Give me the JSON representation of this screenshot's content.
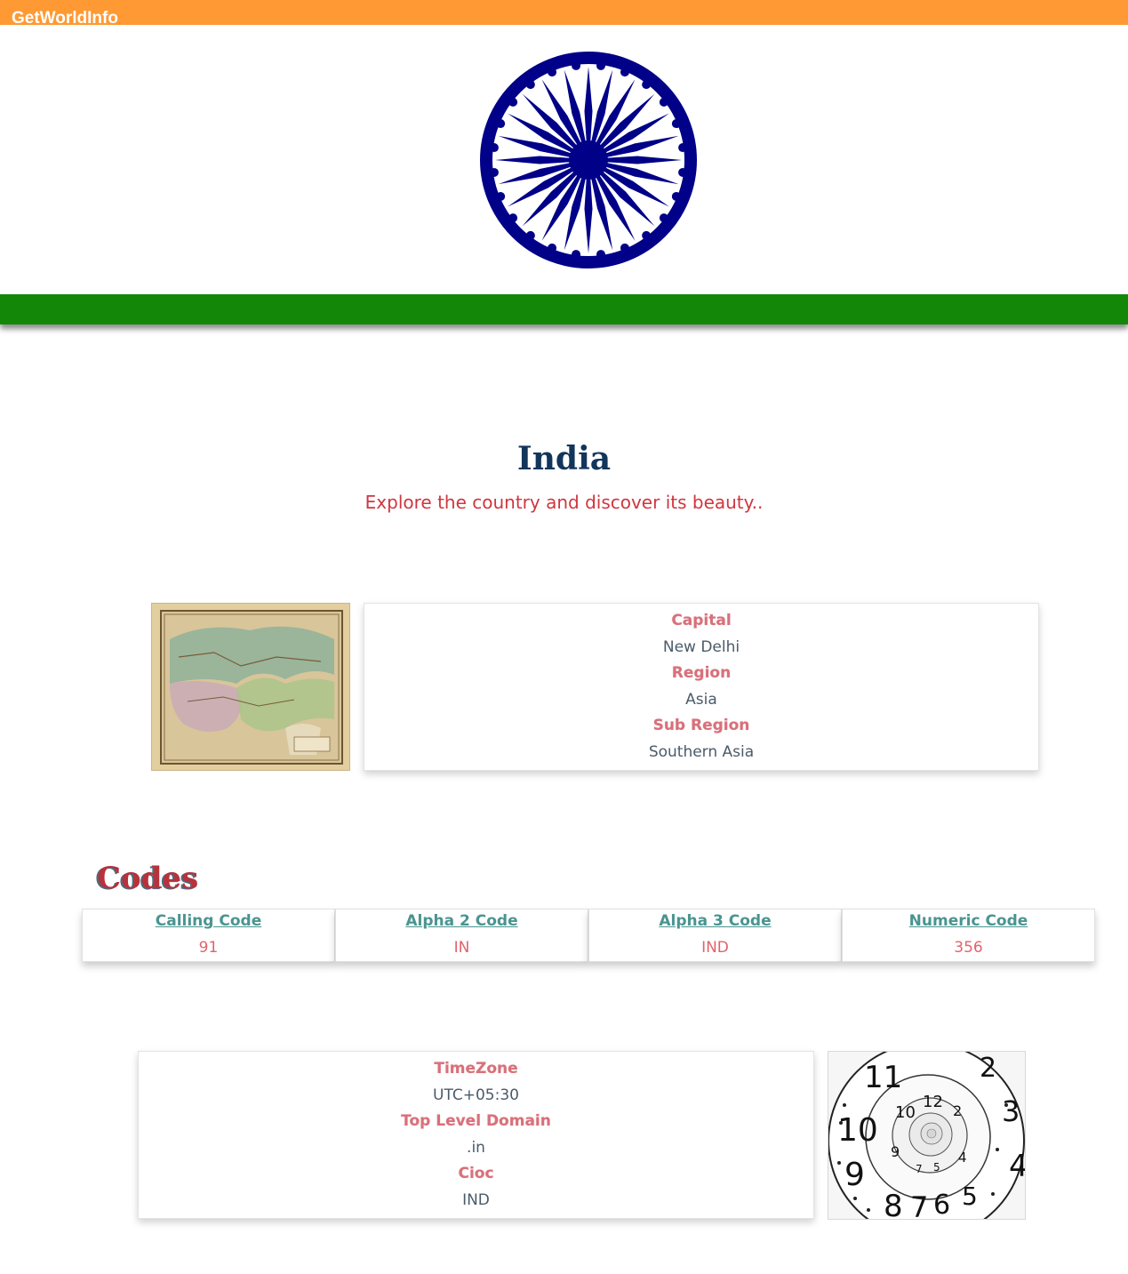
{
  "header": {
    "brand": "GetWorldInfo",
    "flag_colors": {
      "saffron": "#ff9933",
      "white": "#ffffff",
      "green": "#138808",
      "chakra": "#000088"
    }
  },
  "hero": {
    "country_name": "India",
    "tagline": "Explore the country and discover its beauty.."
  },
  "geography": {
    "capital_label": "Capital",
    "capital_value": "New Delhi",
    "region_label": "Region",
    "region_value": "Asia",
    "subregion_label": "Sub Region",
    "subregion_value": "Southern Asia"
  },
  "codes": {
    "title": "Codes",
    "items": [
      {
        "label": "Calling Code",
        "value": "91"
      },
      {
        "label": "Alpha 2 Code",
        "value": "IN"
      },
      {
        "label": "Alpha 3 Code",
        "value": "IND"
      },
      {
        "label": "Numeric Code",
        "value": "356"
      }
    ]
  },
  "time": {
    "timezone_label": "TimeZone",
    "timezone_value": "UTC+05:30",
    "tld_label": "Top Level Domain",
    "tld_value": ".in",
    "cioc_label": "Cioc",
    "cioc_value": "IND"
  },
  "colors": {
    "title": "#12355b",
    "tagline": "#d0363f",
    "label": "#d9707a",
    "code_label": "#4a9490",
    "code_value": "#e2636b"
  }
}
